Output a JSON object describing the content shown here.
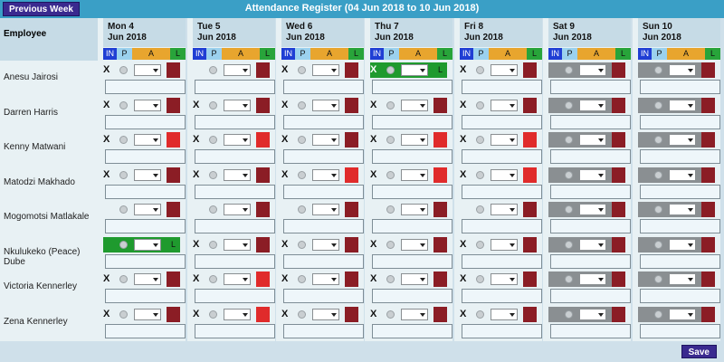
{
  "toolbar": {
    "prev_week_label": "Previous Week",
    "title": "Attendance Register (04 Jun 2018 to 10 Jun 2018)",
    "save_label": "Save"
  },
  "employee_header": "Employee",
  "legend": {
    "in": "IN",
    "p": "P",
    "a": "A",
    "l": "L"
  },
  "colors": {
    "maroon": "#8b1d25",
    "red": "#e02b2b",
    "green": "#1f9a2e",
    "grey": "#8a8f92"
  },
  "days": [
    {
      "label": "Mon 4",
      "date": "Jun 2018"
    },
    {
      "label": "Tue 5",
      "date": "Jun 2018"
    },
    {
      "label": "Wed 6",
      "date": "Jun 2018"
    },
    {
      "label": "Thu 7",
      "date": "Jun 2018"
    },
    {
      "label": "Fri 8",
      "date": "Jun 2018"
    },
    {
      "label": "Sat 9",
      "date": "Jun 2018"
    },
    {
      "label": "Sun 10",
      "date": "Jun 2018"
    }
  ],
  "employees": [
    {
      "name": "Anesu Jairosi",
      "cells": [
        {
          "x": "X",
          "state": "",
          "sw": "maroon"
        },
        {
          "x": "",
          "state": "",
          "sw": "maroon"
        },
        {
          "x": "X",
          "state": "",
          "sw": "maroon"
        },
        {
          "x": "X",
          "state": "green",
          "sw": "green"
        },
        {
          "x": "X",
          "state": "",
          "sw": "maroon"
        },
        {
          "x": "",
          "state": "grey",
          "sw": "maroon"
        },
        {
          "x": "",
          "state": "grey",
          "sw": "maroon"
        }
      ]
    },
    {
      "name": "Darren Harris",
      "cells": [
        {
          "x": "X",
          "state": "",
          "sw": "maroon"
        },
        {
          "x": "X",
          "state": "",
          "sw": "maroon"
        },
        {
          "x": "X",
          "state": "",
          "sw": "maroon"
        },
        {
          "x": "X",
          "state": "",
          "sw": "maroon"
        },
        {
          "x": "X",
          "state": "",
          "sw": "maroon"
        },
        {
          "x": "",
          "state": "grey",
          "sw": "maroon"
        },
        {
          "x": "",
          "state": "grey",
          "sw": "maroon"
        }
      ]
    },
    {
      "name": "Kenny Matwani",
      "cells": [
        {
          "x": "X",
          "state": "",
          "sw": "red"
        },
        {
          "x": "X",
          "state": "",
          "sw": "red"
        },
        {
          "x": "X",
          "state": "",
          "sw": "maroon"
        },
        {
          "x": "X",
          "state": "",
          "sw": "red"
        },
        {
          "x": "X",
          "state": "",
          "sw": "red"
        },
        {
          "x": "",
          "state": "grey",
          "sw": "maroon"
        },
        {
          "x": "",
          "state": "grey",
          "sw": "maroon"
        }
      ]
    },
    {
      "name": "Matodzi Makhado",
      "cells": [
        {
          "x": "X",
          "state": "",
          "sw": "maroon"
        },
        {
          "x": "X",
          "state": "",
          "sw": "maroon"
        },
        {
          "x": "X",
          "state": "",
          "sw": "red"
        },
        {
          "x": "X",
          "state": "",
          "sw": "red"
        },
        {
          "x": "X",
          "state": "",
          "sw": "red"
        },
        {
          "x": "",
          "state": "grey",
          "sw": "maroon"
        },
        {
          "x": "",
          "state": "grey",
          "sw": "maroon"
        }
      ]
    },
    {
      "name": "Mogomotsi Matlakale",
      "cells": [
        {
          "x": "",
          "state": "",
          "sw": "maroon"
        },
        {
          "x": "",
          "state": "",
          "sw": "maroon"
        },
        {
          "x": "",
          "state": "",
          "sw": "maroon"
        },
        {
          "x": "",
          "state": "",
          "sw": "maroon"
        },
        {
          "x": "",
          "state": "",
          "sw": "maroon"
        },
        {
          "x": "",
          "state": "grey",
          "sw": "maroon"
        },
        {
          "x": "",
          "state": "grey",
          "sw": "maroon"
        }
      ]
    },
    {
      "name": "Nkulukeko (Peace) Dube",
      "cells": [
        {
          "x": "",
          "state": "green",
          "sw": "green"
        },
        {
          "x": "X",
          "state": "",
          "sw": "maroon"
        },
        {
          "x": "X",
          "state": "",
          "sw": "maroon"
        },
        {
          "x": "X",
          "state": "",
          "sw": "maroon"
        },
        {
          "x": "X",
          "state": "",
          "sw": "maroon"
        },
        {
          "x": "",
          "state": "grey",
          "sw": "maroon"
        },
        {
          "x": "",
          "state": "grey",
          "sw": "maroon"
        }
      ]
    },
    {
      "name": "Victoria Kennerley",
      "cells": [
        {
          "x": "X",
          "state": "",
          "sw": "maroon"
        },
        {
          "x": "X",
          "state": "",
          "sw": "red"
        },
        {
          "x": "X",
          "state": "",
          "sw": "maroon"
        },
        {
          "x": "X",
          "state": "",
          "sw": "maroon"
        },
        {
          "x": "X",
          "state": "",
          "sw": "maroon"
        },
        {
          "x": "",
          "state": "grey",
          "sw": "maroon"
        },
        {
          "x": "",
          "state": "grey",
          "sw": "maroon"
        }
      ]
    },
    {
      "name": "Zena Kennerley",
      "cells": [
        {
          "x": "X",
          "state": "",
          "sw": "maroon"
        },
        {
          "x": "X",
          "state": "",
          "sw": "red"
        },
        {
          "x": "X",
          "state": "",
          "sw": "maroon"
        },
        {
          "x": "X",
          "state": "",
          "sw": "maroon"
        },
        {
          "x": "X",
          "state": "",
          "sw": "maroon"
        },
        {
          "x": "",
          "state": "grey",
          "sw": "maroon"
        },
        {
          "x": "",
          "state": "grey",
          "sw": "maroon"
        }
      ]
    }
  ]
}
